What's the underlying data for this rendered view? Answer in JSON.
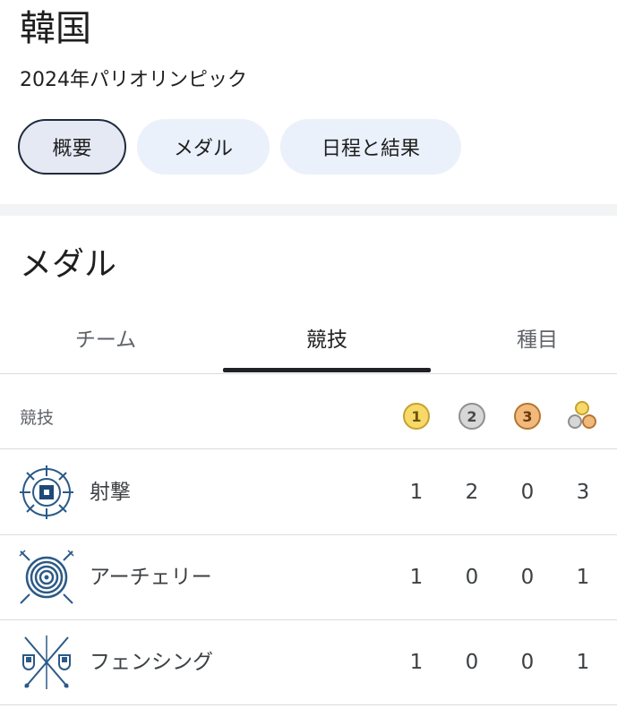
{
  "header": {
    "country": "韓国",
    "event": "2024年パリオリンピック"
  },
  "chips": [
    {
      "label": "概要",
      "active": true
    },
    {
      "label": "メダル",
      "active": false
    },
    {
      "label": "日程と結果",
      "active": false
    }
  ],
  "medals_section": {
    "title": "メダル",
    "tabs": [
      {
        "label": "チーム",
        "selected": false
      },
      {
        "label": "競技",
        "selected": true
      },
      {
        "label": "種目",
        "selected": false
      }
    ],
    "table": {
      "column_label": "競技",
      "medal_columns": {
        "gold": "1",
        "silver": "2",
        "bronze": "3",
        "total_icon": "medal-total-icon"
      },
      "rows": [
        {
          "sport": "射撃",
          "icon": "shooting-icon",
          "gold": "1",
          "silver": "2",
          "bronze": "0",
          "total": "3"
        },
        {
          "sport": "アーチェリー",
          "icon": "archery-icon",
          "gold": "1",
          "silver": "0",
          "bronze": "0",
          "total": "1"
        },
        {
          "sport": "フェンシング",
          "icon": "fencing-icon",
          "gold": "1",
          "silver": "0",
          "bronze": "0",
          "total": "1"
        }
      ]
    }
  },
  "colors": {
    "gold": "#f7d96a",
    "silver": "#d7d7d7",
    "bronze": "#f2b97d",
    "sport_icon": "#2b5a87",
    "chip_bg": "#eaf1fb"
  }
}
